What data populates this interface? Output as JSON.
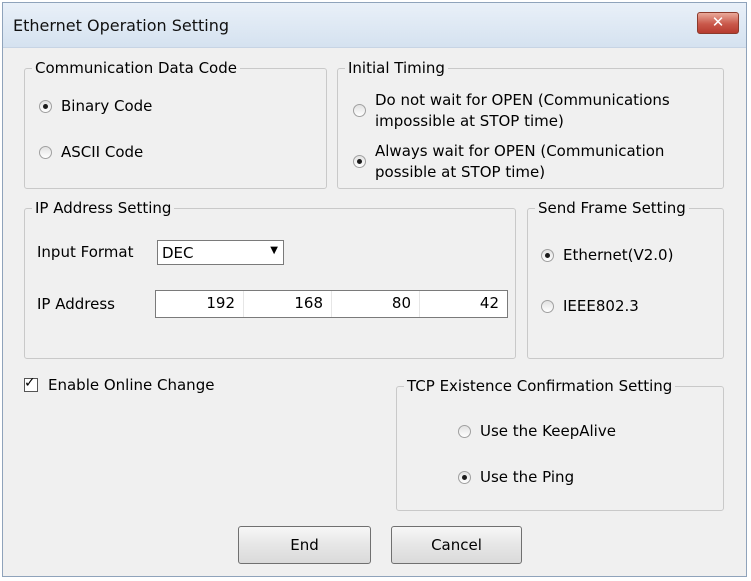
{
  "window": {
    "title": "Ethernet Operation Setting",
    "close_glyph": "✕"
  },
  "communication_data_code": {
    "legend": "Communication Data Code",
    "options": [
      {
        "label": "Binary Code",
        "selected": true
      },
      {
        "label": "ASCII Code",
        "selected": false
      }
    ]
  },
  "initial_timing": {
    "legend": "Initial Timing",
    "options": [
      {
        "line1": "Do not wait for OPEN (Communications",
        "line2": "impossible at STOP time)",
        "selected": false
      },
      {
        "line1": "Always wait for OPEN (Communication",
        "line2": "possible at STOP time)",
        "selected": true
      }
    ]
  },
  "ip_address_setting": {
    "legend": "IP Address Setting",
    "input_format_label": "Input Format",
    "input_format_value": "DEC",
    "ip_address_label": "IP Address",
    "octets": [
      "192",
      "168",
      "80",
      "42"
    ]
  },
  "send_frame_setting": {
    "legend": "Send Frame Setting",
    "options": [
      {
        "label": "Ethernet(V2.0)",
        "selected": true
      },
      {
        "label": "IEEE802.3",
        "selected": false
      }
    ]
  },
  "enable_online_change": {
    "label": "Enable Online Change",
    "checked": true,
    "mark": "✓"
  },
  "tcp_existence": {
    "legend": "TCP Existence Confirmation Setting",
    "options": [
      {
        "label": "Use the KeepAlive",
        "selected": false
      },
      {
        "label": "Use the Ping",
        "selected": true
      }
    ]
  },
  "buttons": {
    "end": "End",
    "cancel": "Cancel"
  },
  "icons": {
    "close": "close-icon",
    "dropdown": "chevron-down-icon"
  }
}
